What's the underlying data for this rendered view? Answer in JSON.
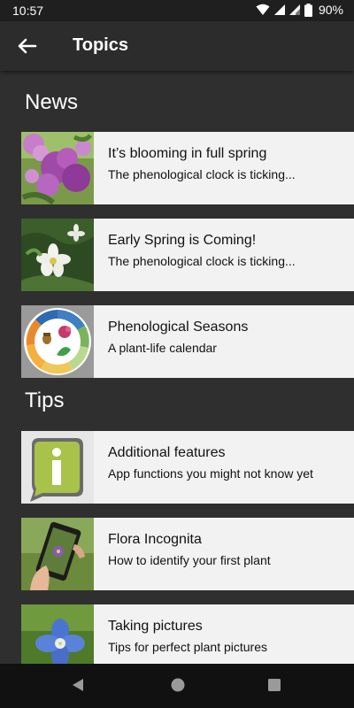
{
  "status_bar": {
    "time": "10:57",
    "battery": "90%",
    "icons": [
      "wifi-icon",
      "signal-icon",
      "signal-icon",
      "battery-icon"
    ]
  },
  "app_bar": {
    "back_icon": "arrow-left-icon",
    "title": "Topics"
  },
  "sections": {
    "news": {
      "title": "News",
      "items": [
        {
          "title": "It’s blooming in full spring",
          "subtitle": "The phenological clock is ticking...",
          "thumb": "lilac-flowers-photo"
        },
        {
          "title": "Early Spring is Coming!",
          "subtitle": "The phenological clock is ticking...",
          "thumb": "white-anemone-photo"
        },
        {
          "title": "Phenological Seasons",
          "subtitle": "A plant-life calendar",
          "thumb": "phenological-clock-diagram"
        }
      ]
    },
    "tips": {
      "title": "Tips",
      "items": [
        {
          "title": "Additional features",
          "subtitle": "App functions you might not know yet",
          "thumb": "info-bubble-icon"
        },
        {
          "title": "Flora Incognita",
          "subtitle": "How to identify your first plant",
          "thumb": "phone-camera-photo"
        },
        {
          "title": "Taking pictures",
          "subtitle": "Tips for perfect plant pictures",
          "thumb": "blue-flower-photo"
        }
      ]
    }
  },
  "nav_bar": {
    "buttons": [
      "back-triangle-icon",
      "home-circle-icon",
      "recents-square-icon"
    ]
  },
  "colors": {
    "background": "#2f2f2f",
    "app_bar": "#2c2c2c",
    "card": "#f2f2f2",
    "nav_bar": "#111111"
  }
}
